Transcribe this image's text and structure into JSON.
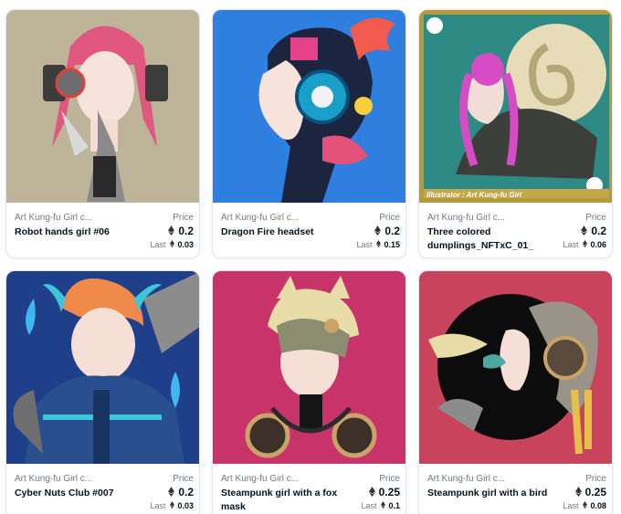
{
  "cards": [
    {
      "collection": "Art Kung-fu Girl c...",
      "name": "Robot hands girl #06",
      "price_label": "Price",
      "price": "0.2",
      "last_label": "Last",
      "last": "0.03"
    },
    {
      "collection": "Art Kung-fu Girl c...",
      "name": "Dragon Fire headset",
      "price_label": "Price",
      "price": "0.2",
      "last_label": "Last",
      "last": "0.15"
    },
    {
      "collection": "Art Kung-fu Girl c...",
      "name": "Three colored dumplings_NFTxC_01_",
      "price_label": "Price",
      "price": "0.2",
      "last_label": "Last",
      "last": "0.06",
      "artwork_caption": "Illustrator : Art Kung-fu Girl"
    },
    {
      "collection": "Art Kung-fu Girl c...",
      "name": "Cyber Nuts Club #007",
      "price_label": "Price",
      "price": "0.2",
      "last_label": "Last",
      "last": "0.03"
    },
    {
      "collection": "Art Kung-fu Girl c...",
      "name": "Steampunk girl with a fox mask",
      "price_label": "Price",
      "price": "0.25",
      "last_label": "Last",
      "last": "0.1"
    },
    {
      "collection": "Art Kung-fu Girl c...",
      "name": "Steampunk girl with a bird",
      "price_label": "Price",
      "price": "0.25",
      "last_label": "Last",
      "last": "0.08"
    }
  ],
  "colors": {
    "card1_bg": "#bdb49a",
    "card2_bg": "#2f7fe0",
    "card3_bg": "#2e8a84",
    "card4_bg": "#1f3f8a",
    "card5_bg": "#c8336a",
    "card6_bg": "#c9435c"
  }
}
